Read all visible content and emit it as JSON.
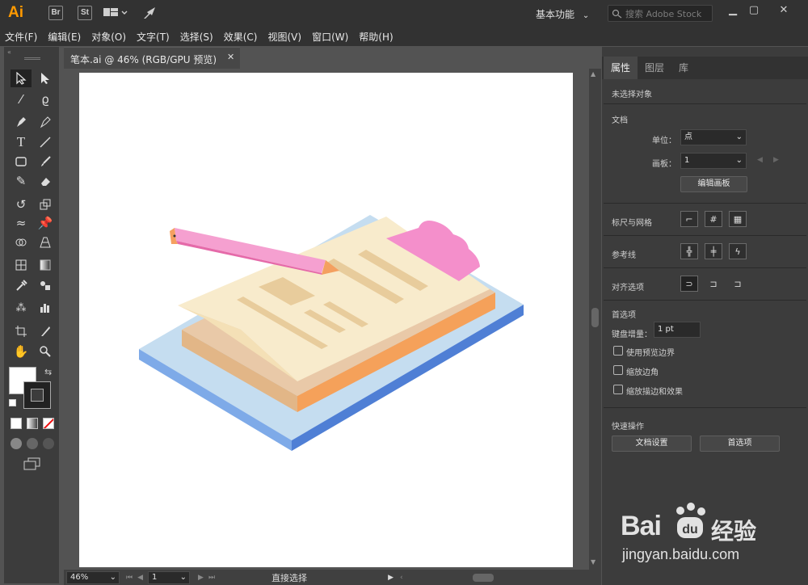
{
  "app": {
    "logo": "Ai",
    "bridge_label": "Br",
    "stock_label": "St",
    "workspace": "基本功能",
    "search_placeholder": "搜索 Adobe Stock"
  },
  "menu": [
    "文件(F)",
    "编辑(E)",
    "对象(O)",
    "文字(T)",
    "选择(S)",
    "效果(C)",
    "视图(V)",
    "窗口(W)",
    "帮助(H)"
  ],
  "document": {
    "tab_title": "笔本.ai @ 46% (RGB/GPU 预览)",
    "zoom": "46%",
    "artboard_index": "1",
    "status_tool": "直接选择"
  },
  "panel": {
    "tabs": [
      "属性",
      "图层",
      "库"
    ],
    "no_selection": "未选择对象",
    "doc_section": "文档",
    "unit_label": "单位：",
    "unit_value": "点",
    "artboard_label": "画板：",
    "artboard_value": "1",
    "edit_artboard_btn": "编辑画板",
    "ruler_grid": "标尺与网格",
    "guides": "参考线",
    "snap_options": "对齐选项",
    "preferences": "首选项",
    "keyboard_inc_label": "键盘增量：",
    "keyboard_inc_value": "1 pt",
    "checks": [
      "使用预览边界",
      "缩放边角",
      "缩放描边和效果"
    ],
    "quick_actions": "快速操作",
    "doc_setup_btn": "文档设置",
    "prefs_btn": "首选项"
  },
  "watermark": {
    "brand": "Bai",
    "brand_cn": "经验",
    "url": "jingyan.baidu.com"
  },
  "colors": {
    "accent": "#ff9a00",
    "clipboard": "#c5ddf0",
    "clipboard_edge": "#5f8fd8",
    "paper": "#f8ebcc",
    "paper_side": "#f5a15a",
    "pencil": "#f295c8",
    "clip": "#f48fcb"
  }
}
